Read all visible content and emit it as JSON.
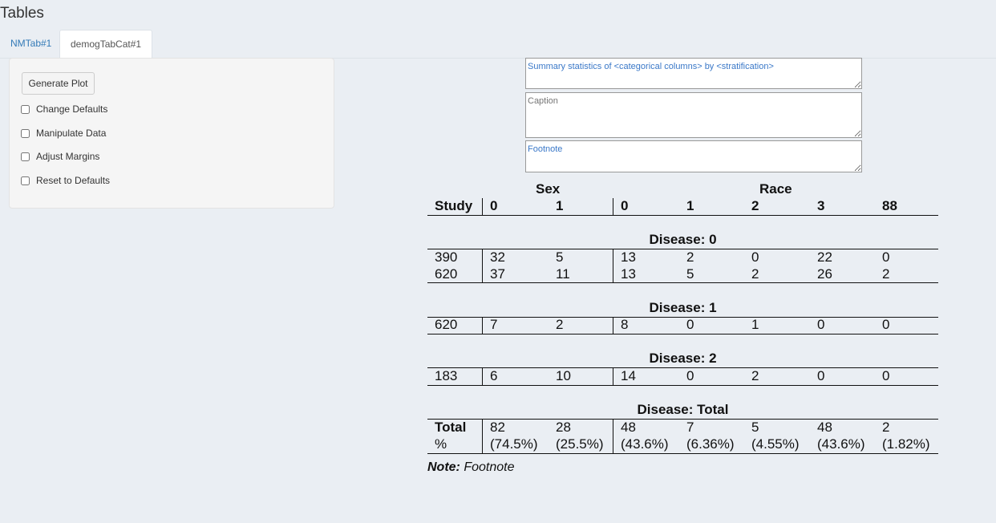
{
  "page": {
    "title": "Tables"
  },
  "tabs": [
    {
      "label": "NMTab#1"
    },
    {
      "label": "demogTabCat#1"
    }
  ],
  "sidebar": {
    "generate_label": "Generate Plot",
    "options": [
      "Change Defaults",
      "Manipulate Data",
      "Adjust Margins",
      "Reset to Defaults"
    ]
  },
  "inputs": {
    "title_value": "Summary statistics of <categorical columns> by <stratification>",
    "caption_placeholder": "Caption",
    "footnote_value": "Footnote"
  },
  "table": {
    "group_headers": {
      "sex": "Sex",
      "race": "Race"
    },
    "columns": [
      "Study",
      "0",
      "1",
      "0",
      "1",
      "2",
      "3",
      "88"
    ],
    "sections": [
      {
        "title": "Disease: 0",
        "rows": [
          [
            "390",
            "32",
            "5",
            "13",
            "2",
            "0",
            "22",
            "0"
          ],
          [
            "620",
            "37",
            "11",
            "13",
            "5",
            "2",
            "26",
            "2"
          ]
        ]
      },
      {
        "title": "Disease: 1",
        "rows": [
          [
            "620",
            "7",
            "2",
            "8",
            "0",
            "1",
            "0",
            "0"
          ]
        ]
      },
      {
        "title": "Disease: 2",
        "rows": [
          [
            "183",
            "6",
            "10",
            "14",
            "0",
            "2",
            "0",
            "0"
          ]
        ]
      },
      {
        "title": "Disease: Total",
        "rows": [
          [
            "Total",
            "82",
            "28",
            "48",
            "7",
            "5",
            "48",
            "2"
          ],
          [
            "%",
            "(74.5%)",
            "(25.5%)",
            "(43.6%)",
            "(6.36%)",
            "(4.55%)",
            "(43.6%)",
            "(1.82%)"
          ]
        ]
      }
    ]
  },
  "note": {
    "label": "Note:",
    "text": "Footnote"
  }
}
